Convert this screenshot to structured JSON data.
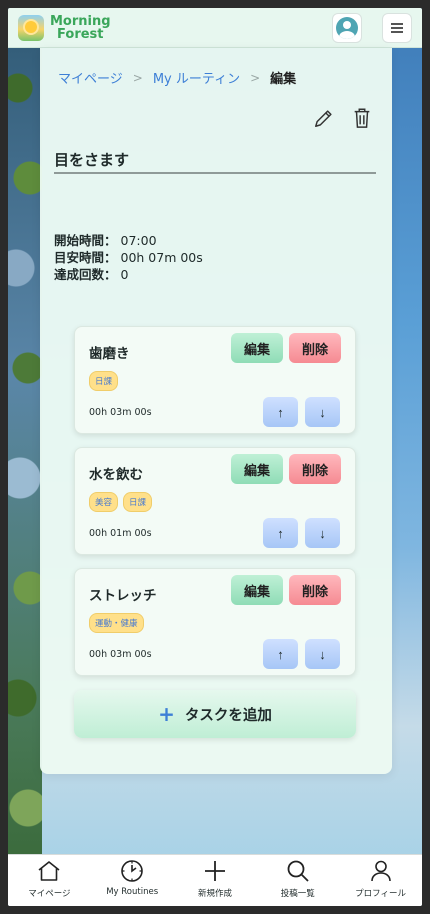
{
  "header": {
    "brand_line1": "Morning",
    "brand_line2": "Forest"
  },
  "breadcrumb": {
    "items": [
      "マイページ",
      "My ルーティン"
    ],
    "current": "編集",
    "separator": ">"
  },
  "routine": {
    "title": "目をさます",
    "stats": [
      {
        "label": "開始時間：",
        "value": "07:00"
      },
      {
        "label": "目安時間：",
        "value": "00h 07m 00s"
      },
      {
        "label": "達成回数：",
        "value": "0"
      }
    ]
  },
  "tasks": [
    {
      "name": "歯磨き",
      "tags": [
        "日課"
      ],
      "duration": "00h 03m 00s"
    },
    {
      "name": "水を飲む",
      "tags": [
        "美容",
        "日課"
      ],
      "duration": "00h 01m 00s"
    },
    {
      "name": "ストレッチ",
      "tags": [
        "運動・健康"
      ],
      "duration": "00h 03m 00s"
    }
  ],
  "task_buttons": {
    "edit": "編集",
    "delete": "削除",
    "up": "↑",
    "down": "↓"
  },
  "add_task": {
    "plus": "+",
    "label": "タスクを追加"
  },
  "bottom_nav": [
    {
      "label": "マイページ",
      "icon": "home-icon"
    },
    {
      "label": "My Routines",
      "icon": "clock-icon"
    },
    {
      "label": "新規作成",
      "icon": "plus-icon"
    },
    {
      "label": "投稿一覧",
      "icon": "search-icon"
    },
    {
      "label": "プロフィール",
      "icon": "user-icon"
    }
  ],
  "colors": {
    "brand": "#3aa65a",
    "link": "#3d7fd6",
    "edit_button": "#8fdcb6",
    "delete_button": "#f58a92",
    "move_button": "#a6c6f6",
    "tag": "#ffe08a"
  }
}
